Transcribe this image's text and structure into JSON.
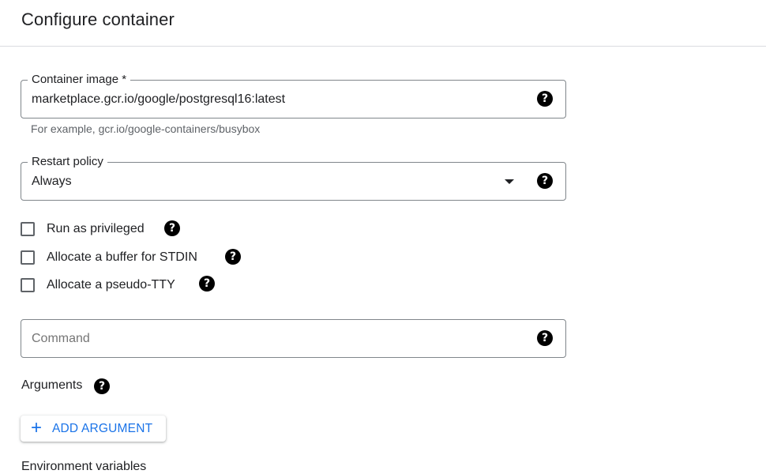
{
  "header": {
    "title": "Configure container"
  },
  "container_image": {
    "label": "Container image *",
    "value": "marketplace.gcr.io/google/postgresql16:latest",
    "hint": "For example, gcr.io/google-containers/busybox",
    "help_glyph": "?"
  },
  "restart_policy": {
    "label": "Restart policy",
    "value": "Always",
    "help_glyph": "?"
  },
  "checkboxes": [
    {
      "label": "Run as privileged",
      "checked": false
    },
    {
      "label": "Allocate a buffer for STDIN",
      "checked": false
    },
    {
      "label": "Allocate a pseudo-TTY",
      "checked": false
    }
  ],
  "command": {
    "placeholder": "Command",
    "value": "",
    "help_glyph": "?"
  },
  "arguments": {
    "title": "Arguments",
    "help_glyph": "?",
    "add_button_icon": "+",
    "add_button_label": "ADD ARGUMENT"
  },
  "next_section": {
    "title_partial": "Environment variables"
  },
  "colors": {
    "accent": "#1a73e8",
    "border": "#80868b",
    "divider": "#dadce0",
    "text": "#202124",
    "hint": "#5f6368"
  },
  "icons": {
    "help": "help-circle-icon",
    "dropdown": "arrow-drop-down-icon",
    "add": "plus-icon"
  }
}
